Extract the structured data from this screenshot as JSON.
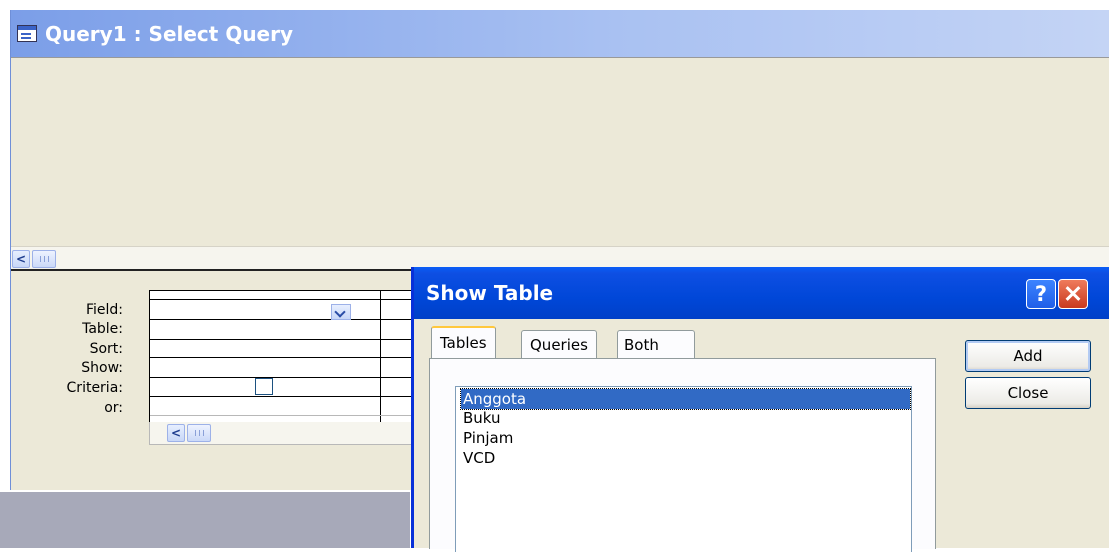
{
  "query_window": {
    "title": "Query1 : Select Query",
    "grid_labels": {
      "field": "Field:",
      "table": "Table:",
      "sort": "Sort:",
      "show": "Show:",
      "criteria": "Criteria:",
      "or": "or:"
    },
    "show_checked": false
  },
  "show_table_dialog": {
    "title": "Show Table",
    "help_icon": "?",
    "tabs": [
      {
        "label": "Tables",
        "active": true
      },
      {
        "label": "Queries",
        "active": false
      },
      {
        "label": "Both",
        "active": false
      }
    ],
    "items": [
      "Anggota",
      "Buku",
      "Pinjam",
      "VCD"
    ],
    "selected_item": "Anggota",
    "buttons": {
      "add": "Add",
      "close": "Close"
    }
  },
  "colors": {
    "dialog_title": "#0047d8",
    "selection": "#316ac5",
    "window_face": "#ece9d8"
  },
  "icons": {
    "query_window": "query-window-icon",
    "scroll_left": "chevron-left-icon",
    "field_dropdown": "chevron-down-icon",
    "help": "question-icon",
    "close": "close-icon"
  }
}
